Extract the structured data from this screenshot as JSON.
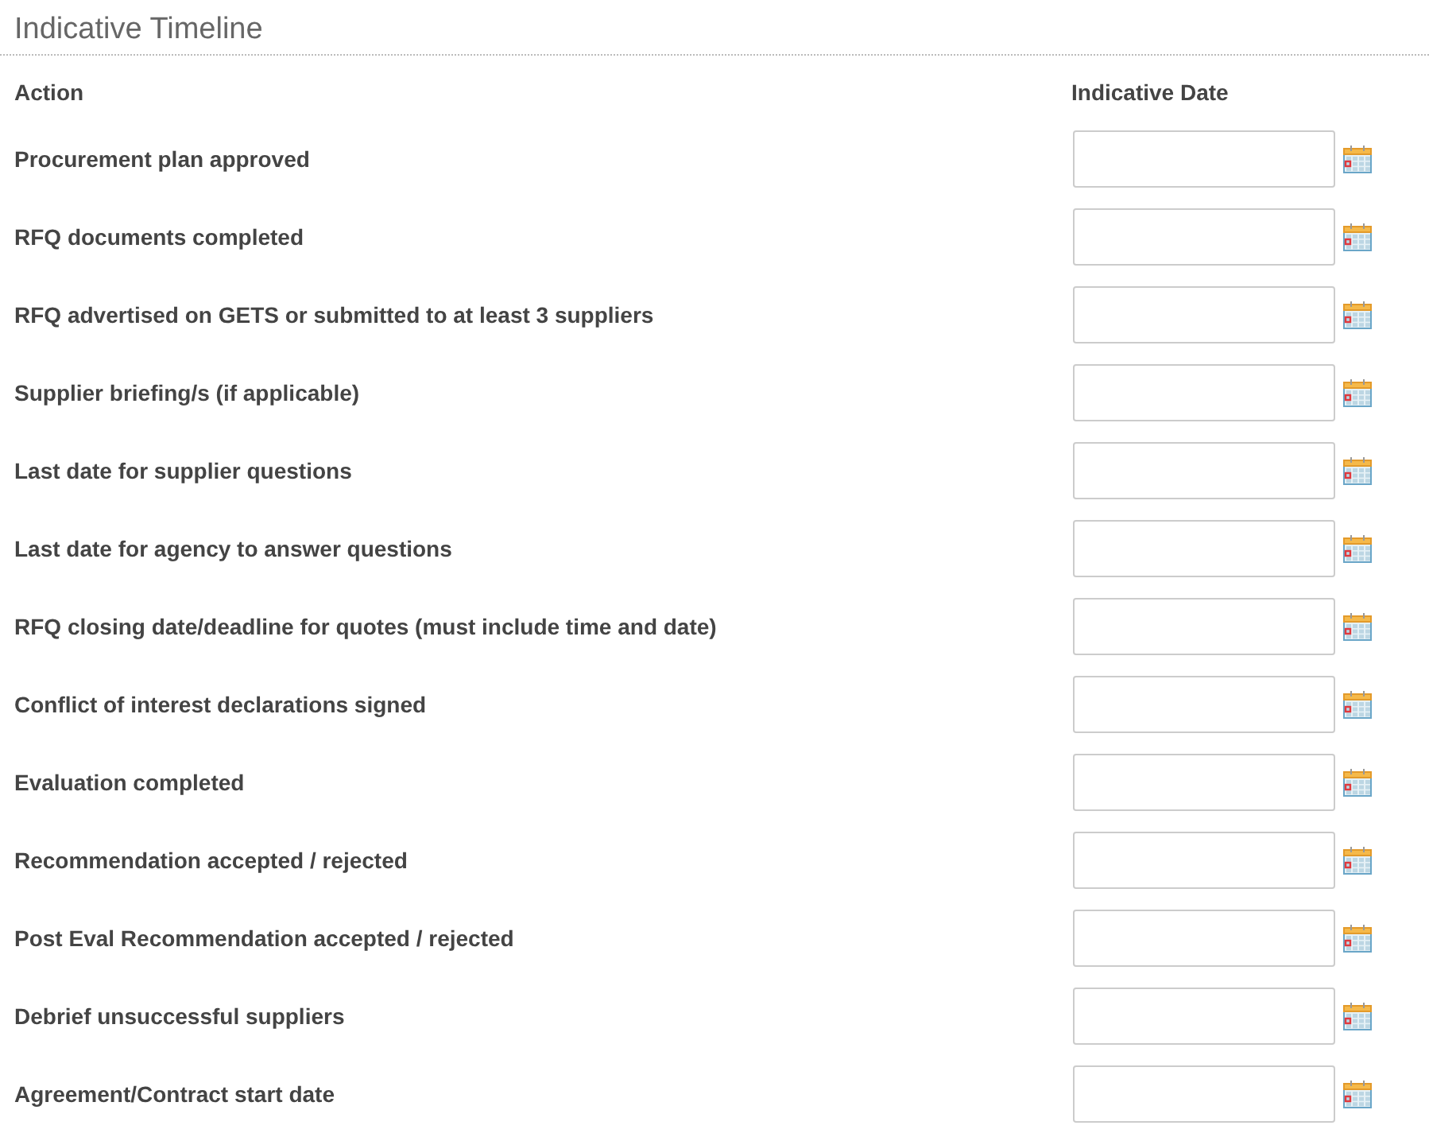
{
  "title": "Indicative Timeline",
  "columns": [
    "Action",
    "Indicative Date"
  ],
  "rows": [
    {
      "action": "Procurement plan approved"
    },
    {
      "action": "RFQ documents completed"
    },
    {
      "action": "RFQ advertised on GETS or submitted to at least 3 suppliers"
    },
    {
      "action": "Supplier briefing/s (if applicable)"
    },
    {
      "action": "Last date for supplier questions"
    },
    {
      "action": "Last date for agency to answer questions"
    },
    {
      "action": "RFQ closing date/deadline for quotes (must include time and date)"
    },
    {
      "action": "Conflict of interest declarations signed"
    },
    {
      "action": "Evaluation completed"
    },
    {
      "action": "Recommendation accepted / rejected"
    },
    {
      "action": "Post Eval Recommendation accepted / rejected"
    },
    {
      "action": "Debrief unsuccessful suppliers"
    },
    {
      "action": "Agreement/Contract start date"
    }
  ]
}
